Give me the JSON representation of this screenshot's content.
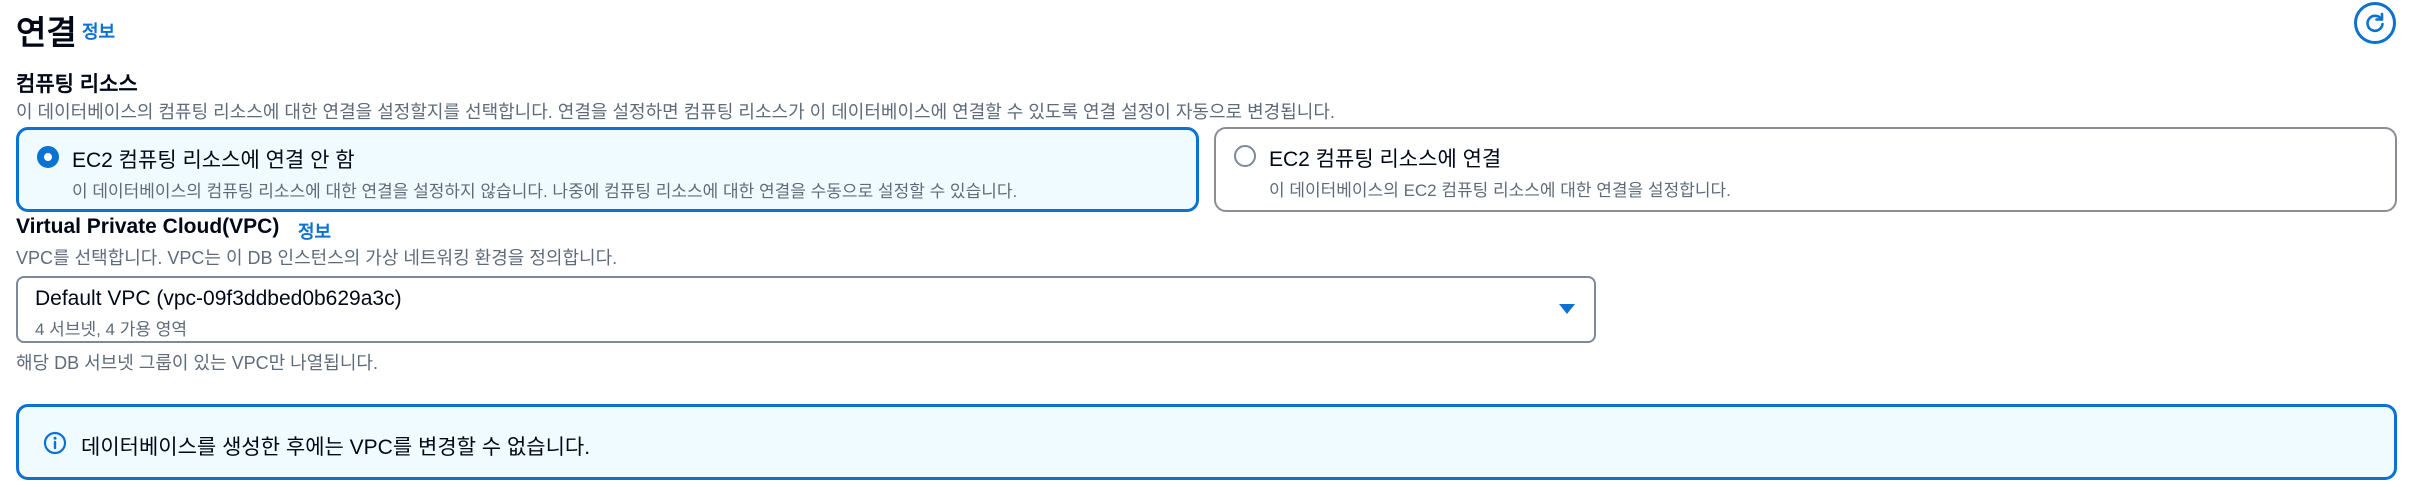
{
  "header": {
    "title": "연결",
    "info_link": "정보",
    "refresh_icon": "refresh-icon"
  },
  "compute": {
    "label": "컴퓨팅 리소스",
    "description": "이 데이터베이스의 컴퓨팅 리소스에 대한 연결을 설정할지를 선택합니다. 연결을 설정하면 컴퓨팅 리소스가 이 데이터베이스에 연결할 수 있도록 연결 설정이 자동으로 변경됩니다.",
    "options": [
      {
        "title": "EC2 컴퓨팅 리소스에 연결 안 함",
        "description": "이 데이터베이스의 컴퓨팅 리소스에 대한 연결을 설정하지 않습니다. 나중에 컴퓨팅 리소스에 대한 연결을 수동으로 설정할 수 있습니다.",
        "selected": true
      },
      {
        "title": "EC2 컴퓨팅 리소스에 연결",
        "description": "이 데이터베이스의 EC2 컴퓨팅 리소스에 대한 연결을 설정합니다.",
        "selected": false
      }
    ]
  },
  "vpc": {
    "label": "Virtual Private Cloud(VPC)",
    "info_link": "정보",
    "description": "VPC를 선택합니다. VPC는 이 DB 인스턴스의 가상 네트워킹 환경을 정의합니다.",
    "selected_value": "Default VPC (vpc-09f3ddbed0b629a3c)",
    "selected_sub": "4 서브넷, 4 가용 영역",
    "hint": "해당 DB 서브넷 그룹이 있는 VPC만 나열됩니다."
  },
  "alert": {
    "icon": "info-icon",
    "text": "데이터베이스를 생성한 후에는 VPC를 변경할 수 없습니다."
  },
  "colors": {
    "accent": "#0972d3",
    "selected_bg": "#f0fbff",
    "text": "#000716",
    "secondary_text": "#5f6b7a",
    "border": "#8c8c94"
  }
}
